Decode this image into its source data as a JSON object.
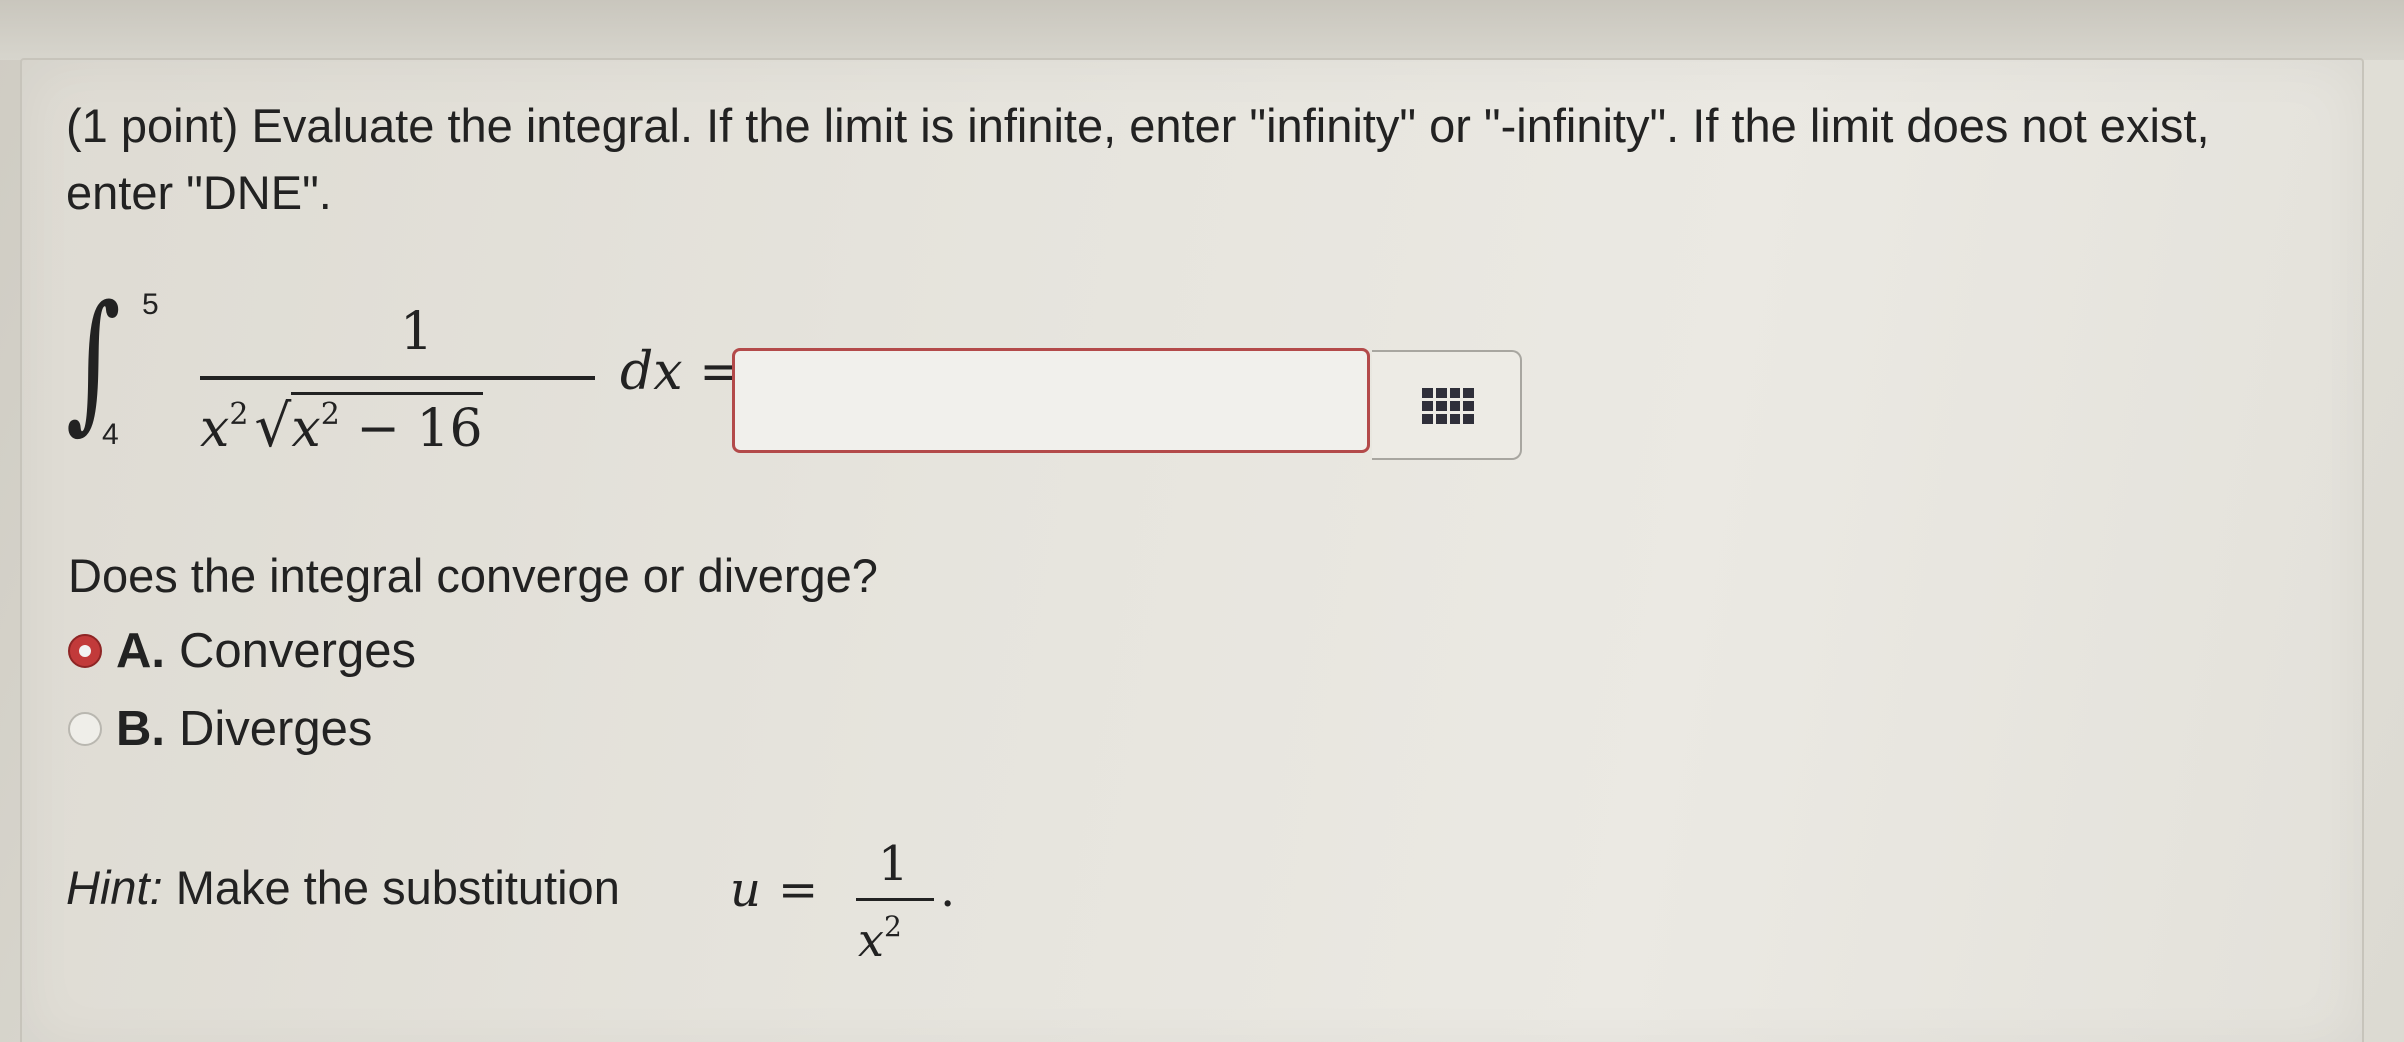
{
  "problem": {
    "prompt": "(1 point) Evaluate the integral. If the limit is infinite, enter \"infinity\" or \"-infinity\". If the limit does not exist, enter \"DNE\".",
    "integral": {
      "sign": "∫",
      "upper_limit": "5",
      "lower_limit": "4",
      "numerator": "1",
      "denominator_var": "x",
      "denominator_exp": "2",
      "radical": "√",
      "radicand_var": "x",
      "radicand_exp": "2",
      "radicand_rest": " − 16",
      "differential": "d",
      "differential_var": "x",
      "equals": " ="
    },
    "answer_value": "",
    "keypad_icon": "keypad-grid-icon"
  },
  "question": {
    "text": "Does the integral converge or diverge?",
    "options": [
      {
        "letter": "A.",
        "label": "Converges",
        "selected": true
      },
      {
        "letter": "B.",
        "label": "Diverges",
        "selected": false
      }
    ]
  },
  "hint": {
    "label": "Hint:",
    "text": " Make the substitution ",
    "var": "u",
    "equals": "=",
    "numerator": "1",
    "denominator_var": "x",
    "denominator_exp": "2",
    "period": "."
  },
  "colors": {
    "selected_radio": "#c23a3a",
    "answer_border": "#b34a4a"
  }
}
